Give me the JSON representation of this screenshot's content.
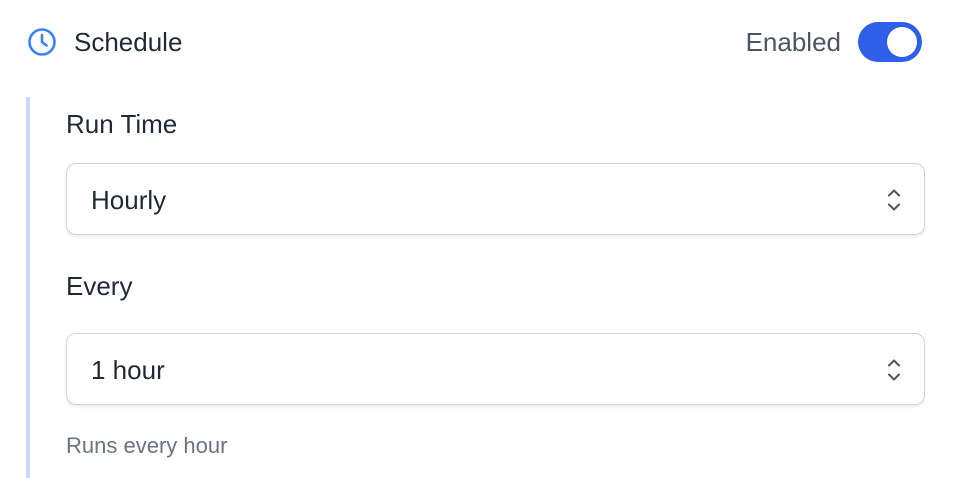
{
  "header": {
    "icon": "clock-icon",
    "title": "Schedule",
    "enabled_label": "Enabled",
    "enabled": true,
    "accent_color": "#2f5fe8"
  },
  "run_time": {
    "label": "Run Time",
    "selected": "Hourly",
    "icon": "chevron-updown-icon"
  },
  "every": {
    "label": "Every",
    "selected": "1 hour",
    "icon": "chevron-updown-icon"
  },
  "help_text": "Runs every hour"
}
